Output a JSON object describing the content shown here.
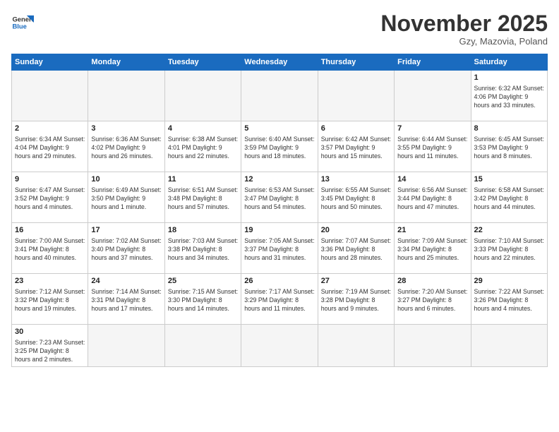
{
  "logo": {
    "general": "General",
    "blue": "Blue"
  },
  "title": "November 2025",
  "location": "Gzy, Mazovia, Poland",
  "days_of_week": [
    "Sunday",
    "Monday",
    "Tuesday",
    "Wednesday",
    "Thursday",
    "Friday",
    "Saturday"
  ],
  "weeks": [
    [
      {
        "day": "",
        "info": ""
      },
      {
        "day": "",
        "info": ""
      },
      {
        "day": "",
        "info": ""
      },
      {
        "day": "",
        "info": ""
      },
      {
        "day": "",
        "info": ""
      },
      {
        "day": "",
        "info": ""
      },
      {
        "day": "1",
        "info": "Sunrise: 6:32 AM\nSunset: 4:06 PM\nDaylight: 9 hours\nand 33 minutes."
      }
    ],
    [
      {
        "day": "2",
        "info": "Sunrise: 6:34 AM\nSunset: 4:04 PM\nDaylight: 9 hours\nand 29 minutes."
      },
      {
        "day": "3",
        "info": "Sunrise: 6:36 AM\nSunset: 4:02 PM\nDaylight: 9 hours\nand 26 minutes."
      },
      {
        "day": "4",
        "info": "Sunrise: 6:38 AM\nSunset: 4:01 PM\nDaylight: 9 hours\nand 22 minutes."
      },
      {
        "day": "5",
        "info": "Sunrise: 6:40 AM\nSunset: 3:59 PM\nDaylight: 9 hours\nand 18 minutes."
      },
      {
        "day": "6",
        "info": "Sunrise: 6:42 AM\nSunset: 3:57 PM\nDaylight: 9 hours\nand 15 minutes."
      },
      {
        "day": "7",
        "info": "Sunrise: 6:44 AM\nSunset: 3:55 PM\nDaylight: 9 hours\nand 11 minutes."
      },
      {
        "day": "8",
        "info": "Sunrise: 6:45 AM\nSunset: 3:53 PM\nDaylight: 9 hours\nand 8 minutes."
      }
    ],
    [
      {
        "day": "9",
        "info": "Sunrise: 6:47 AM\nSunset: 3:52 PM\nDaylight: 9 hours\nand 4 minutes."
      },
      {
        "day": "10",
        "info": "Sunrise: 6:49 AM\nSunset: 3:50 PM\nDaylight: 9 hours\nand 1 minute."
      },
      {
        "day": "11",
        "info": "Sunrise: 6:51 AM\nSunset: 3:48 PM\nDaylight: 8 hours\nand 57 minutes."
      },
      {
        "day": "12",
        "info": "Sunrise: 6:53 AM\nSunset: 3:47 PM\nDaylight: 8 hours\nand 54 minutes."
      },
      {
        "day": "13",
        "info": "Sunrise: 6:55 AM\nSunset: 3:45 PM\nDaylight: 8 hours\nand 50 minutes."
      },
      {
        "day": "14",
        "info": "Sunrise: 6:56 AM\nSunset: 3:44 PM\nDaylight: 8 hours\nand 47 minutes."
      },
      {
        "day": "15",
        "info": "Sunrise: 6:58 AM\nSunset: 3:42 PM\nDaylight: 8 hours\nand 44 minutes."
      }
    ],
    [
      {
        "day": "16",
        "info": "Sunrise: 7:00 AM\nSunset: 3:41 PM\nDaylight: 8 hours\nand 40 minutes."
      },
      {
        "day": "17",
        "info": "Sunrise: 7:02 AM\nSunset: 3:40 PM\nDaylight: 8 hours\nand 37 minutes."
      },
      {
        "day": "18",
        "info": "Sunrise: 7:03 AM\nSunset: 3:38 PM\nDaylight: 8 hours\nand 34 minutes."
      },
      {
        "day": "19",
        "info": "Sunrise: 7:05 AM\nSunset: 3:37 PM\nDaylight: 8 hours\nand 31 minutes."
      },
      {
        "day": "20",
        "info": "Sunrise: 7:07 AM\nSunset: 3:36 PM\nDaylight: 8 hours\nand 28 minutes."
      },
      {
        "day": "21",
        "info": "Sunrise: 7:09 AM\nSunset: 3:34 PM\nDaylight: 8 hours\nand 25 minutes."
      },
      {
        "day": "22",
        "info": "Sunrise: 7:10 AM\nSunset: 3:33 PM\nDaylight: 8 hours\nand 22 minutes."
      }
    ],
    [
      {
        "day": "23",
        "info": "Sunrise: 7:12 AM\nSunset: 3:32 PM\nDaylight: 8 hours\nand 19 minutes."
      },
      {
        "day": "24",
        "info": "Sunrise: 7:14 AM\nSunset: 3:31 PM\nDaylight: 8 hours\nand 17 minutes."
      },
      {
        "day": "25",
        "info": "Sunrise: 7:15 AM\nSunset: 3:30 PM\nDaylight: 8 hours\nand 14 minutes."
      },
      {
        "day": "26",
        "info": "Sunrise: 7:17 AM\nSunset: 3:29 PM\nDaylight: 8 hours\nand 11 minutes."
      },
      {
        "day": "27",
        "info": "Sunrise: 7:19 AM\nSunset: 3:28 PM\nDaylight: 8 hours\nand 9 minutes."
      },
      {
        "day": "28",
        "info": "Sunrise: 7:20 AM\nSunset: 3:27 PM\nDaylight: 8 hours\nand 6 minutes."
      },
      {
        "day": "29",
        "info": "Sunrise: 7:22 AM\nSunset: 3:26 PM\nDaylight: 8 hours\nand 4 minutes."
      }
    ],
    [
      {
        "day": "30",
        "info": "Sunrise: 7:23 AM\nSunset: 3:25 PM\nDaylight: 8 hours\nand 2 minutes."
      },
      {
        "day": "",
        "info": ""
      },
      {
        "day": "",
        "info": ""
      },
      {
        "day": "",
        "info": ""
      },
      {
        "day": "",
        "info": ""
      },
      {
        "day": "",
        "info": ""
      },
      {
        "day": "",
        "info": ""
      }
    ]
  ]
}
